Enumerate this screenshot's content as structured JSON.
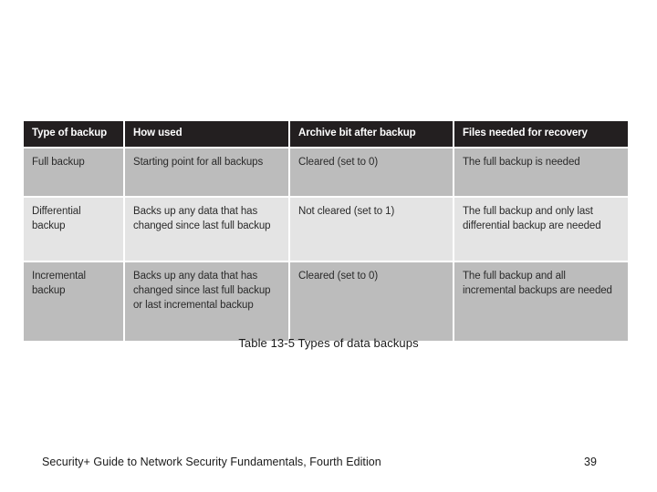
{
  "slide": {
    "background_color": "#ffffff",
    "caption": "Table 13-5 Types of data backups"
  },
  "table": {
    "header_bg_color": "#231f20",
    "header_text_color": "#ffffff",
    "band_dark_color": "#bcbcbc",
    "band_light_color": "#e4e4e4",
    "columns": [
      "Type of backup",
      "How used",
      "Archive bit after backup",
      "Files needed for recovery"
    ],
    "rows": [
      {
        "band": "dark",
        "type_of_backup": "Full backup",
        "how_used": "Starting point for all backups",
        "archive_bit": "Cleared (set to 0)",
        "files_needed": "The full backup is needed"
      },
      {
        "band": "light",
        "type_of_backup": "Differential backup",
        "how_used": "Backs up any data that has changed since last full backup",
        "archive_bit": "Not cleared (set to 1)",
        "files_needed": "The full backup and only last differential backup are needed"
      },
      {
        "band": "dark",
        "type_of_backup": "Incremental backup",
        "how_used": "Backs up any data that has changed since last full backup or last incremental backup",
        "archive_bit": "Cleared (set to 0)",
        "files_needed": "The full backup and all incremental backups are needed"
      }
    ]
  },
  "footer": {
    "title": "Security+ Guide to Network Security Fundamentals, Fourth Edition",
    "page_number": "39"
  }
}
